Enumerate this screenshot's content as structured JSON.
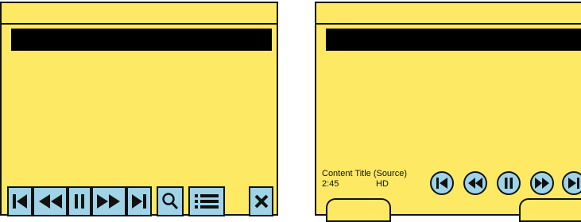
{
  "left_screen": {
    "toolbar": {
      "buttons": [
        {
          "icon": "skip-previous-icon"
        },
        {
          "icon": "rewind-icon"
        },
        {
          "icon": "pause-icon"
        },
        {
          "icon": "fast-forward-icon"
        },
        {
          "icon": "skip-next-icon"
        },
        {
          "icon": "search-icon"
        },
        {
          "icon": "list-icon"
        },
        {
          "icon": "close-icon"
        }
      ]
    }
  },
  "right_screen": {
    "content_title": "Content Title (Source)",
    "duration": "2:45",
    "quality": "HD",
    "controls": [
      {
        "icon": "skip-previous-icon"
      },
      {
        "icon": "rewind-icon"
      },
      {
        "icon": "pause-icon"
      },
      {
        "icon": "fast-forward-icon"
      },
      {
        "icon": "skip-next-icon"
      }
    ]
  },
  "colors": {
    "background": "#fde964",
    "button": "#9fd4e8",
    "outline": "#111111"
  }
}
